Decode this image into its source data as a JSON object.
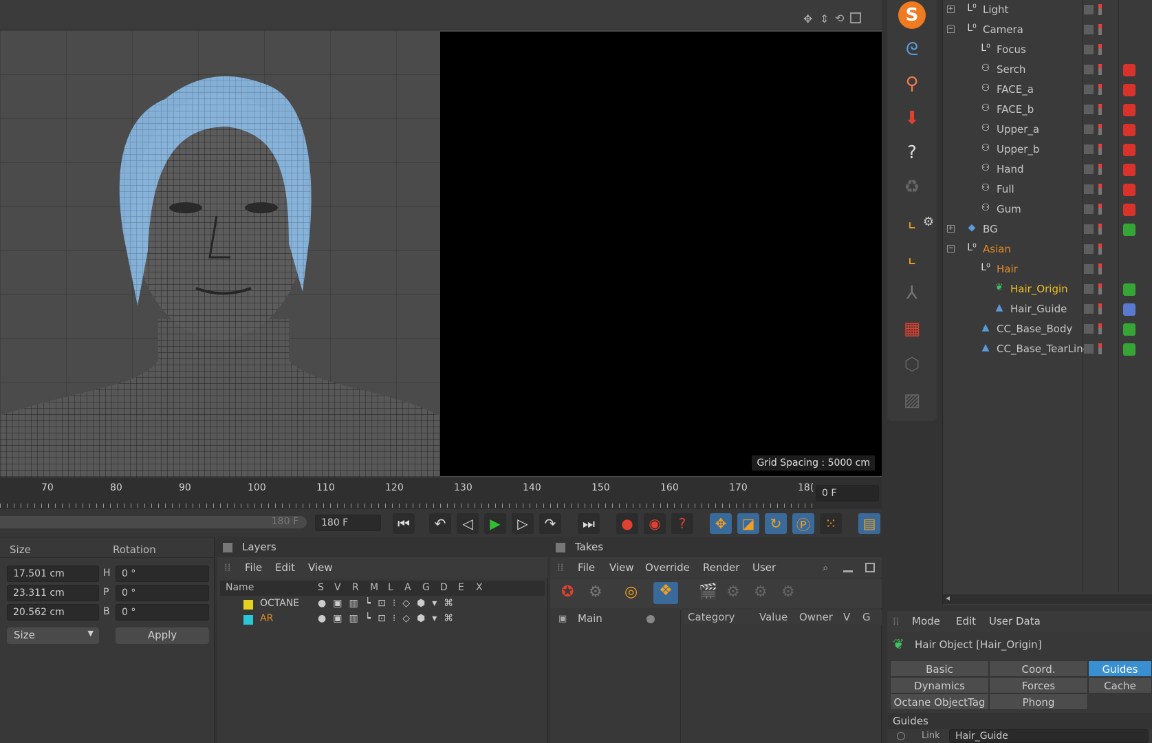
{
  "viewport": {
    "grid_spacing": "Grid Spacing : 5000 cm"
  },
  "timeline": {
    "ticks": [
      "70",
      "80",
      "90",
      "100",
      "110",
      "120",
      "130",
      "140",
      "150",
      "160",
      "170",
      "18("
    ],
    "current_frame": "0 F",
    "end_slider_label": "180 F",
    "end_frame": "180 F"
  },
  "coords": {
    "size_header": "Size",
    "rotation_header": "Rotation",
    "size_x": "17.501 cm",
    "size_y": "23.311 cm",
    "size_z": "20.562 cm",
    "rot_h_label": "H",
    "rot_p_label": "P",
    "rot_b_label": "B",
    "rot_h": "0 °",
    "rot_p": "0 °",
    "rot_b": "0 °",
    "mode": "Size",
    "apply": "Apply"
  },
  "layers": {
    "title": "Layers",
    "menu": [
      "File",
      "Edit",
      "View"
    ],
    "columns": [
      "Name",
      "S",
      "V",
      "R",
      "M",
      "L",
      "A",
      "G",
      "D",
      "E",
      "X"
    ],
    "rows": [
      {
        "name": "OCTANE",
        "color": "#e6d21e"
      },
      {
        "name": "AR",
        "color": "#29c7d6"
      }
    ]
  },
  "takes": {
    "title": "Takes",
    "menu": [
      "File",
      "View",
      "Override",
      "Render",
      "User"
    ],
    "main": "Main",
    "columns": [
      "Category",
      "Value",
      "Owner",
      "V",
      "G"
    ]
  },
  "attributes": {
    "menu": [
      "Mode",
      "Edit",
      "User Data"
    ],
    "object_title": "Hair Object [Hair_Origin]",
    "tabs": [
      "Basic",
      "Coord.",
      "Guides",
      "Dynamics",
      "Forces",
      "Cache",
      "Octane ObjectTag",
      "Phong"
    ],
    "section": "Guides",
    "link_label": "Link",
    "link_value": "Hair_Guide"
  },
  "objects": [
    {
      "name": "Light",
      "indent": 0,
      "icon": "L0",
      "color": "#c8c8c8",
      "tag": ""
    },
    {
      "name": "Camera",
      "indent": 0,
      "icon": "L0",
      "color": "#c8c8c8",
      "tag": ""
    },
    {
      "name": "Focus",
      "indent": 1,
      "icon": "L0",
      "color": "#c8c8c8",
      "tag": ""
    },
    {
      "name": "Serch",
      "indent": 1,
      "icon": "camera",
      "color": "#c8c8c8",
      "tag": "#d8322a"
    },
    {
      "name": "FACE_a",
      "indent": 1,
      "icon": "camera",
      "color": "#c8c8c8",
      "tag": "#d8322a"
    },
    {
      "name": "FACE_b",
      "indent": 1,
      "icon": "camera",
      "color": "#c8c8c8",
      "tag": "#d8322a"
    },
    {
      "name": "Upper_a",
      "indent": 1,
      "icon": "camera",
      "color": "#c8c8c8",
      "tag": "#d8322a"
    },
    {
      "name": "Upper_b",
      "indent": 1,
      "icon": "camera",
      "color": "#c8c8c8",
      "tag": "#d8322a"
    },
    {
      "name": "Hand",
      "indent": 1,
      "icon": "camera",
      "color": "#c8c8c8",
      "tag": "#d8322a"
    },
    {
      "name": "Full",
      "indent": 1,
      "icon": "camera",
      "color": "#c8c8c8",
      "tag": "#d8322a"
    },
    {
      "name": "Gum",
      "indent": 1,
      "icon": "camera",
      "color": "#c8c8c8",
      "tag": "#d8322a"
    },
    {
      "name": "BG",
      "indent": 0,
      "icon": "plane",
      "color": "#c8c8c8",
      "tag": "#35a535"
    },
    {
      "name": "Asian",
      "indent": 0,
      "icon": "L0",
      "color": "#e08a2a",
      "tag": ""
    },
    {
      "name": "Hair",
      "indent": 1,
      "icon": "L0",
      "color": "#e08a2a",
      "tag": ""
    },
    {
      "name": "Hair_Origin",
      "indent": 2,
      "icon": "hair",
      "color": "#f0c020",
      "tag": "#35a535"
    },
    {
      "name": "Hair_Guide",
      "indent": 2,
      "icon": "spline",
      "color": "#c8c8c8",
      "tag": "#5a7ad0"
    },
    {
      "name": "CC_Base_Body",
      "indent": 1,
      "icon": "spline",
      "color": "#c8c8c8",
      "tag": "#35a535"
    },
    {
      "name": "CC_Base_TearLine",
      "indent": 1,
      "icon": "spline",
      "color": "#c8c8c8",
      "tag": "#35a535"
    }
  ],
  "colors": {
    "accent": "#3a8fd0",
    "hair": "#8ec2f0",
    "play": "#2ec02e"
  }
}
